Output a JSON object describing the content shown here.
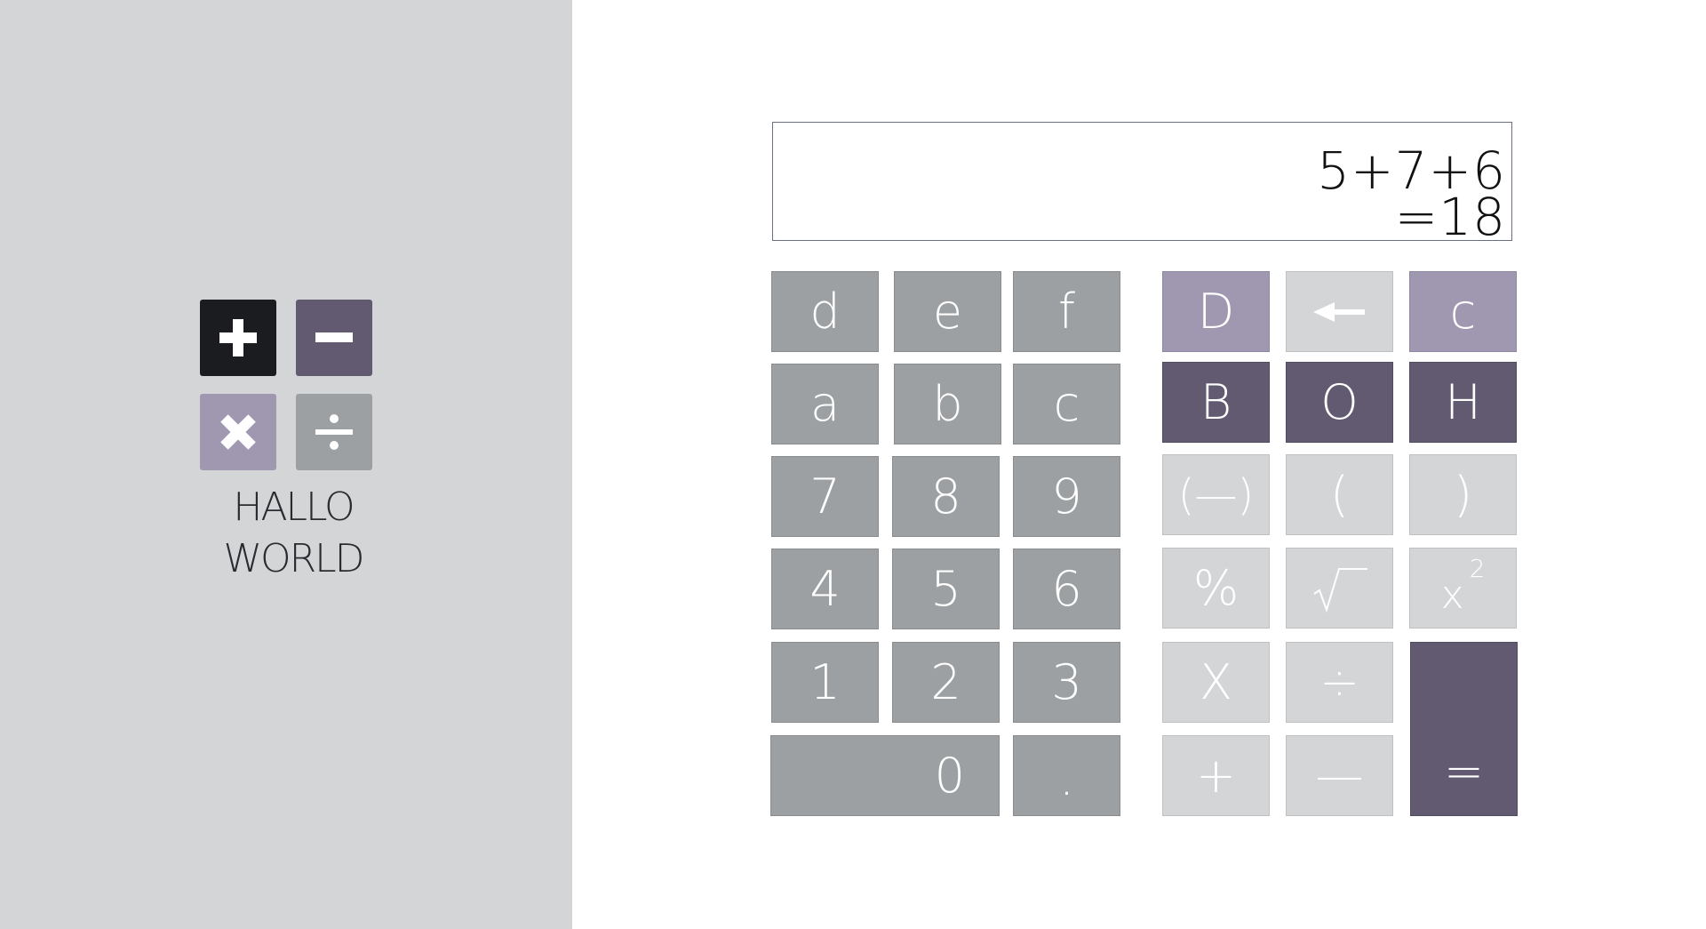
{
  "logo": {
    "line1": "HALLO",
    "line2": "WORLD",
    "tiles": [
      {
        "name": "plus-icon",
        "color": "#1b1c1f"
      },
      {
        "name": "minus-icon",
        "color": "#615a70"
      },
      {
        "name": "times-icon",
        "color": "#a097b1"
      },
      {
        "name": "divide-icon",
        "color": "#9da0a2"
      }
    ]
  },
  "display": {
    "expression": "5+7+6",
    "result": "=18"
  },
  "keys": {
    "d": "d",
    "e": "e",
    "f": "f",
    "a": "a",
    "b": "b",
    "c": "c",
    "seven": "7",
    "eight": "8",
    "nine": "9",
    "four": "4",
    "five": "5",
    "six": "6",
    "one": "1",
    "two": "2",
    "three": "3",
    "zero": "0",
    "dot": ".",
    "dec": "D",
    "clear": "c",
    "bin": "B",
    "oct": "O",
    "hexmode": "H",
    "negate": "(—)",
    "paren_open": "(",
    "paren_close": ")",
    "percent": "%",
    "square_base": "x",
    "square_exp": "2",
    "multiply": "X",
    "divide": "÷",
    "plus": "+",
    "minus": "—",
    "equals": "="
  },
  "colors": {
    "sidebar": "#d4d5d7",
    "hex_key": "#9da0a2",
    "mode_light": "#a097b1",
    "mode_dark": "#615a70",
    "operator_key": "#d4d5d7",
    "equals_key": "#615a70"
  }
}
